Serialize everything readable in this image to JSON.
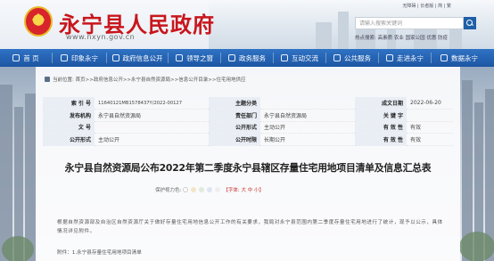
{
  "header": {
    "site_title": "永宁县人民政府",
    "site_url": "www.nxyn.gov.cn",
    "top_links": "无障碍 | 长者版 | 简 | 繁",
    "search_placeholder": "请输入搜索关键词",
    "hot_words": "热点搜索: 高素质 农业 国家公园 优惠 防疫"
  },
  "nav": {
    "items": [
      {
        "label": "首 页",
        "icon": "home-icon"
      },
      {
        "label": "印象永宁",
        "icon": "impression-icon"
      },
      {
        "label": "政府信息公开",
        "icon": "info-icon"
      },
      {
        "label": "领导之窗",
        "icon": "leader-icon"
      },
      {
        "label": "政务服务",
        "icon": "service-icon"
      },
      {
        "label": "互动交流",
        "icon": "chat-icon"
      },
      {
        "label": "公共服务",
        "icon": "public-icon"
      },
      {
        "label": "走进永宁",
        "icon": "enter-icon"
      },
      {
        "label": "数据永宁",
        "icon": "data-icon"
      }
    ]
  },
  "breadcrumb": "当前位置: 首页>>政府信息公开>>永宁县自然资源局>>信息公开目录>>住宅用地供应",
  "info": {
    "index_label": "索 引 号",
    "index_value": "11640121MB1578437Y/2022-00127",
    "subject_label": "主题分类",
    "subject_value": "",
    "date_label": "成文日期",
    "date_value": "2022-06-20",
    "publisher_label": "发布机构",
    "publisher_value": "永宁县自然资源局",
    "dept_label": "责任部门",
    "dept_value": "永宁县自然资源局",
    "keywords_label": "关 键 字",
    "keywords_value": "",
    "docno_label": "文 号",
    "docno_value": "",
    "form_label": "公开形式",
    "form_value": "主动公开",
    "scope_label": "公开时限",
    "scope_value": "长期公开",
    "valid_label": "有 效 性",
    "valid_value": "有效"
  },
  "document": {
    "title": "永宁县自然资源局公布2022年第二季度永宁县辖区存量住宅用地项目清单及信息汇总表",
    "meta": "保护视力色:",
    "font_size_label": "【字体: 大 中 小】",
    "body": "根据自然资源部及自治区自然资源厅关于做好存量住宅用地信息公开工作的有关要求，我局对永宁县范围内第二季度存量住宅用地进行了统计，现予以公示，具体情况详见附件。",
    "attachment": "附件：1.永宁县存量住宅用地项目清单"
  },
  "colors": {
    "title_red": "#c8161d",
    "nav_blue": "#1d56a3",
    "label_bg": "#e9eef5"
  }
}
